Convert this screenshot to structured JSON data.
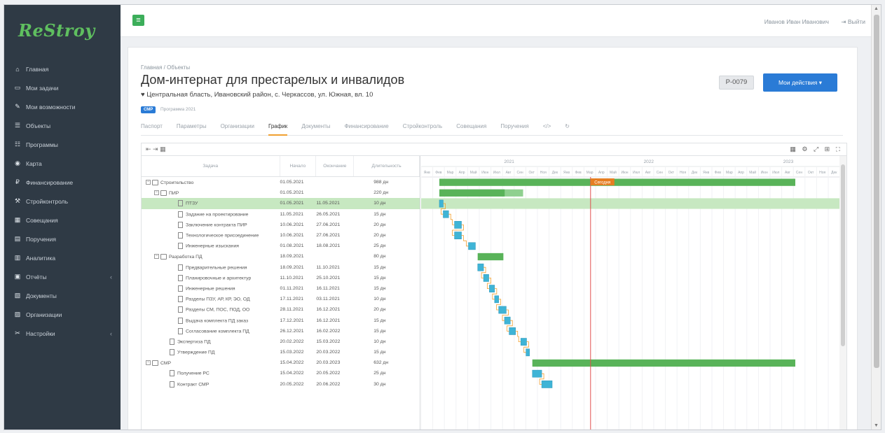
{
  "logo": "ReStroy",
  "sidebar": {
    "items": [
      {
        "icon": "home-icon",
        "glyph": "⌂",
        "label": "Главная"
      },
      {
        "icon": "tasks-icon",
        "glyph": "▭",
        "label": "Мои задачи"
      },
      {
        "icon": "pencil-icon",
        "glyph": "✎",
        "label": "Мои возможности"
      },
      {
        "icon": "list-icon",
        "glyph": "☰",
        "label": "Объекты"
      },
      {
        "icon": "programs-icon",
        "glyph": "☷",
        "label": "Программы"
      },
      {
        "icon": "globe-icon",
        "glyph": "◉",
        "label": "Карта"
      },
      {
        "icon": "finance-icon",
        "glyph": "₽",
        "label": "Финансирование"
      },
      {
        "icon": "build-icon",
        "glyph": "⚒",
        "label": "Стройконтроль"
      },
      {
        "icon": "meeting-icon",
        "glyph": "▦",
        "label": "Совещания"
      },
      {
        "icon": "orders-icon",
        "glyph": "▤",
        "label": "Поручения"
      },
      {
        "icon": "book-icon",
        "glyph": "▥",
        "label": "Аналитика"
      },
      {
        "icon": "reports-icon",
        "glyph": "▣",
        "label": "Отчёты",
        "chev": "‹"
      },
      {
        "icon": "docs-icon",
        "glyph": "▧",
        "label": "Документы"
      },
      {
        "icon": "org-icon",
        "glyph": "▨",
        "label": "Организации"
      },
      {
        "icon": "wrench-icon",
        "glyph": "✂",
        "label": "Настройки",
        "chev": "‹"
      }
    ]
  },
  "topbar": {
    "menu_glyph": "≡",
    "user": "Иванов Иван Иванович",
    "logout": "⇥ Выйти"
  },
  "page": {
    "breadcrumb": "Главная / Объекты",
    "title": "Дом-интернат для престарелых и инвалидов",
    "address": "♥ Центральная бласть, Ивановский район, с. Черкассов, ул. Южная, вл. 10",
    "badge": "СМР",
    "start_label": "Программа 2021",
    "code": "P-0079",
    "actions": "Мои действия ▾"
  },
  "tabs": [
    {
      "label": "Паспорт",
      "active": false
    },
    {
      "label": "Параметры",
      "active": false
    },
    {
      "label": "Организации",
      "active": false
    },
    {
      "label": "График",
      "active": true
    },
    {
      "label": "Документы",
      "active": false
    },
    {
      "label": "Финансирование",
      "active": false
    },
    {
      "label": "Стройконтроль",
      "active": false
    },
    {
      "label": "Совещания",
      "active": false
    },
    {
      "label": "Поручения",
      "active": false
    },
    {
      "label": "</>",
      "active": false
    },
    {
      "label": "↻",
      "active": false
    }
  ],
  "gantt": {
    "toolbar_left": "⇤ ⇥ ▦",
    "toolbar_right": "▦ ⚙ ⤢ ⊞ ⛶",
    "headers": {
      "name": "Задача",
      "start": "Начало",
      "end": "Окончание",
      "dur": "Длительность"
    },
    "today_label": "Сегодня",
    "years": [
      "2021",
      "2022",
      "2023"
    ],
    "months": [
      "Янв",
      "Фев",
      "Мар",
      "Апр",
      "Май",
      "Июн",
      "Июл",
      "Авг",
      "Сен",
      "Окт",
      "Ноя",
      "Дек",
      "Янв",
      "Фев",
      "Мар",
      "Апр",
      "Май",
      "Июн",
      "Июл",
      "Авг",
      "Сен",
      "Окт",
      "Ноя",
      "Дек",
      "Янв",
      "Фев",
      "Мар",
      "Апр",
      "Май",
      "Июн",
      "Июл",
      "Авг",
      "Сен",
      "Окт",
      "Ноя",
      "Дек",
      "Янв"
    ],
    "rows": [
      {
        "level": 0,
        "type": "group",
        "name": "Строительство",
        "start": "01.05.2021",
        "end": "",
        "dur": "988 дн"
      },
      {
        "level": 1,
        "type": "group",
        "name": "ПИР",
        "start": "01.05.2021",
        "end": "",
        "dur": "220 дн"
      },
      {
        "level": 2,
        "type": "task",
        "name": "ПТЗУ",
        "start": "01.05.2021",
        "end": "11.05.2021",
        "dur": "10 дн",
        "selected": true
      },
      {
        "level": 2,
        "type": "task",
        "name": "Задание на проектирование",
        "start": "11.05.2021",
        "end": "26.05.2021",
        "dur": "15 дн"
      },
      {
        "level": 2,
        "type": "task",
        "name": "Заключение контракта ПИР",
        "start": "10.06.2021",
        "end": "27.06.2021",
        "dur": "20 дн"
      },
      {
        "level": 2,
        "type": "task",
        "name": "Технологическое присоединение",
        "start": "10.06.2021",
        "end": "27.06.2021",
        "dur": "20 дн"
      },
      {
        "level": 2,
        "type": "task",
        "name": "Инженерные изыскания",
        "start": "01.08.2021",
        "end": "18.08.2021",
        "dur": "25 дн"
      },
      {
        "level": 1,
        "type": "group",
        "name": "Разработка ПД",
        "start": "18.09.2021",
        "end": "",
        "dur": "80 дн"
      },
      {
        "level": 2,
        "type": "task",
        "name": "Предварительные решения",
        "start": "18.09.2021",
        "end": "11.10.2021",
        "dur": "15 дн"
      },
      {
        "level": 2,
        "type": "task",
        "name": "Планировочные и архитектур",
        "start": "11.10.2021",
        "end": "25.10.2021",
        "dur": "15 дн"
      },
      {
        "level": 2,
        "type": "task",
        "name": "Инженерные решения",
        "start": "01.11.2021",
        "end": "16.11.2021",
        "dur": "15 дн"
      },
      {
        "level": 2,
        "type": "task",
        "name": "Разделы ПЗУ, АР, КР, ЭО, ОД",
        "start": "17.11.2021",
        "end": "03.11.2021",
        "dur": "10 дн"
      },
      {
        "level": 2,
        "type": "task",
        "name": "Разделы СМ, ПОС, ПОД, ОО",
        "start": "28.11.2021",
        "end": "16.12.2021",
        "dur": "20 дн"
      },
      {
        "level": 2,
        "type": "task",
        "name": "Выдача комплекта ПД заказ",
        "start": "17.12.2021",
        "end": "16.12.2021",
        "dur": "15 дн"
      },
      {
        "level": 2,
        "type": "task",
        "name": "Согласование комплекта ПД",
        "start": "26.12.2021",
        "end": "16.02.2022",
        "dur": "15 дн"
      },
      {
        "level": 1,
        "type": "task",
        "name": "Экспертиза ПД",
        "start": "20.02.2022",
        "end": "15.03.2022",
        "dur": "10 дн"
      },
      {
        "level": 1,
        "type": "task",
        "name": "Утверждение ПД",
        "start": "15.03.2022",
        "end": "20.03.2022",
        "dur": "15 дн"
      },
      {
        "level": 0,
        "type": "group",
        "name": "СМР",
        "start": "15.04.2022",
        "end": "20.03.2023",
        "dur": "632 дн"
      },
      {
        "level": 1,
        "type": "task",
        "name": "Получение РС",
        "start": "15.04.2022",
        "end": "20.05.2022",
        "dur": "25 дн"
      },
      {
        "level": 1,
        "type": "task",
        "name": "Контракт СМР",
        "start": "20.05.2022",
        "end": "20.06.2022",
        "dur": "30 дн"
      }
    ],
    "bars": [
      {
        "kind": "summary",
        "from": 0.0,
        "to": 30.6,
        "progress": 1.0
      },
      {
        "kind": "summary",
        "from": 0.0,
        "to": 7.2,
        "progress": 0.78
      },
      {
        "kind": "task",
        "from": 0.0,
        "to": 0.33
      },
      {
        "kind": "task",
        "from": 0.33,
        "to": 0.8
      },
      {
        "kind": "task",
        "from": 1.3,
        "to": 1.9
      },
      {
        "kind": "task",
        "from": 1.3,
        "to": 1.9
      },
      {
        "kind": "task",
        "from": 2.5,
        "to": 3.1
      },
      {
        "kind": "summary",
        "from": 3.3,
        "to": 5.5,
        "progress": 1.0
      },
      {
        "kind": "task",
        "from": 3.3,
        "to": 3.8
      },
      {
        "kind": "task",
        "from": 3.8,
        "to": 4.25
      },
      {
        "kind": "task",
        "from": 4.3,
        "to": 4.75
      },
      {
        "kind": "task",
        "from": 4.75,
        "to": 5.1
      },
      {
        "kind": "task",
        "from": 5.1,
        "to": 5.75
      },
      {
        "kind": "task",
        "from": 5.6,
        "to": 6.1
      },
      {
        "kind": "task",
        "from": 6.0,
        "to": 6.55
      },
      {
        "kind": "task",
        "from": 7.0,
        "to": 7.5
      },
      {
        "kind": "task",
        "from": 7.45,
        "to": 7.7
      },
      {
        "kind": "summary",
        "from": 8.0,
        "to": 30.6,
        "progress": 1.0
      },
      {
        "kind": "task",
        "from": 8.0,
        "to": 8.8
      },
      {
        "kind": "task",
        "from": 8.8,
        "to": 9.7
      }
    ],
    "today_month": 13.0,
    "colors": {
      "summary": "#59b359",
      "summary_light": "#8fd08f",
      "task": "#3fb4d6",
      "link": "#f0a030",
      "today": "#e05050",
      "selected_row": "#c7e8c1"
    }
  }
}
